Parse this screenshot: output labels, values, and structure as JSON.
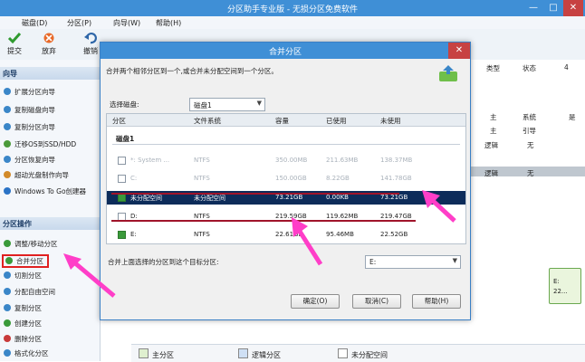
{
  "app": {
    "title": "分区助手专业版 - 无损分区免费软件",
    "window_buttons": [
      "—",
      "□",
      "✕"
    ]
  },
  "menu": [
    "磁盘(D)",
    "分区(P)",
    "向导(W)",
    "帮助(H)"
  ],
  "toolbar": [
    {
      "label": "提交",
      "icon": "check-icon"
    },
    {
      "label": "放弃",
      "icon": "discard-icon"
    },
    {
      "label": "撤销",
      "icon": "undo-icon"
    }
  ],
  "sidebar": {
    "wizard_header": "向导",
    "wizard_items": [
      "扩展分区向导",
      "复制磁盘向导",
      "复制分区向导",
      "迁移OS到SSD/HDD",
      "分区恢复向导",
      "超动光盘制作向导",
      "Windows To Go创建器"
    ],
    "ops_header": "分区操作",
    "ops_items": [
      "调整/移动分区",
      "合并分区",
      "切割分区",
      "分配自由空间",
      "复制分区",
      "创建分区",
      "删除分区",
      "格式化分区"
    ]
  },
  "background_table": {
    "headers": [
      "类型",
      "状态",
      "4"
    ],
    "rows": [
      [
        "主",
        "系统",
        "是"
      ],
      [
        "主",
        "引导",
        ""
      ],
      [
        "逻辑",
        "无",
        ""
      ],
      [
        "逻辑",
        "无",
        ""
      ]
    ]
  },
  "legend": [
    "主分区",
    "逻辑分区",
    "未分配空间"
  ],
  "diskmap": {
    "label": "E:",
    "size": "22..."
  },
  "dialog": {
    "title": "合并分区",
    "close": "✕",
    "description": "合并两个相邻分区到一个,或合并未分配空间到一个分区。",
    "disk_label": "选择磁盘:",
    "disk_value": "磁盘1",
    "table_headers": [
      "分区",
      "文件系统",
      "容量",
      "已使用",
      "未使用"
    ],
    "group": "磁盘1",
    "rows": [
      {
        "name": "*: System ...",
        "fs": "NTFS",
        "cap": "350.00MB",
        "used": "211.63MB",
        "free": "138.37MB",
        "checked": false,
        "selected": false,
        "dim": true
      },
      {
        "name": "C:",
        "fs": "NTFS",
        "cap": "150.00GB",
        "used": "8.22GB",
        "free": "141.78GB",
        "checked": false,
        "selected": false,
        "dim": true
      },
      {
        "name": "未分配空间",
        "fs": "未分配空间",
        "cap": "73.21GB",
        "used": "0.00KB",
        "free": "73.21GB",
        "checked": true,
        "selected": true,
        "dim": false
      },
      {
        "name": "D:",
        "fs": "NTFS",
        "cap": "219.59GB",
        "used": "119.62MB",
        "free": "219.47GB",
        "checked": false,
        "selected": false,
        "dim": false
      },
      {
        "name": "E:",
        "fs": "NTFS",
        "cap": "22.61GB",
        "used": "95.46MB",
        "free": "22.52GB",
        "checked": true,
        "selected": false,
        "dim": false
      }
    ],
    "merge_label": "合并上面选择的分区到这个目标分区:",
    "target_value": "E:",
    "buttons": [
      "确定(O)",
      "取消(C)",
      "帮助(H)"
    ]
  },
  "colors": {
    "accent": "#3f8fd6",
    "annotation": "#ff3ec8",
    "underline": "#a0142a"
  }
}
